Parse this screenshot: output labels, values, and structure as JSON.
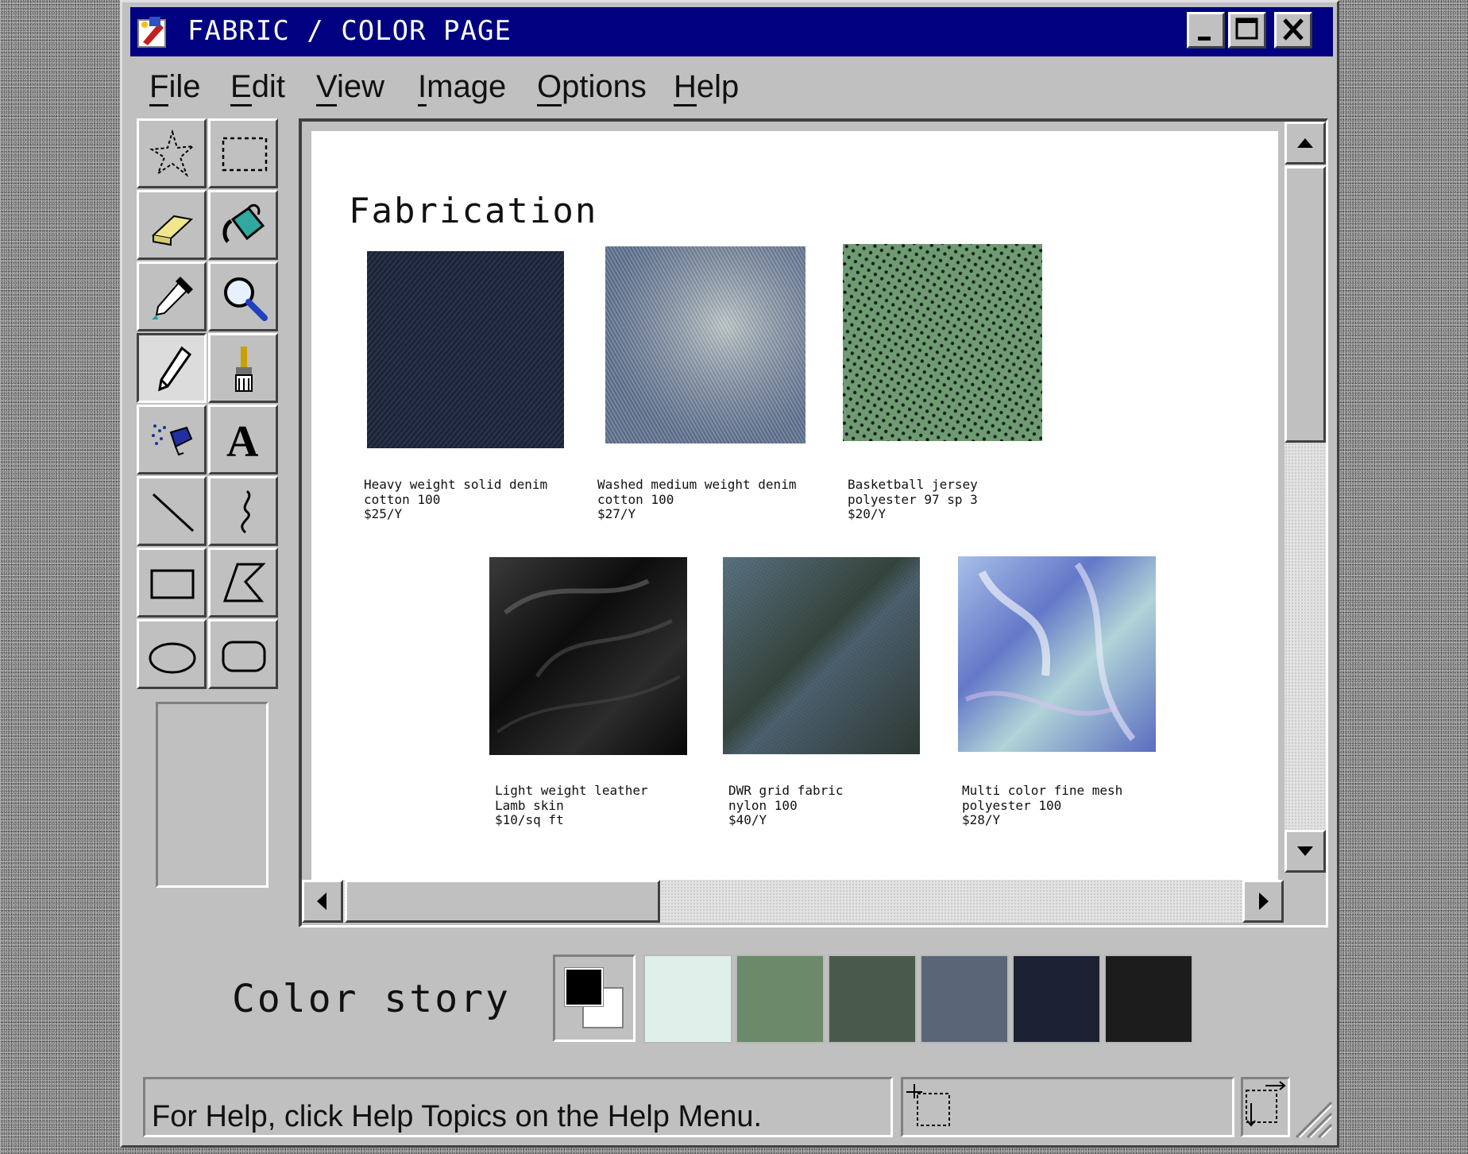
{
  "window": {
    "title": "FABRIC / COLOR PAGE",
    "icon": "paint-app-icon",
    "controls": [
      "minimize-icon",
      "maximize-icon",
      "close-icon"
    ]
  },
  "menu": {
    "items": [
      {
        "label": "File",
        "mnemonic": "F"
      },
      {
        "label": "Edit",
        "mnemonic": "E"
      },
      {
        "label": "View",
        "mnemonic": "V"
      },
      {
        "label": "Image",
        "mnemonic": "I"
      },
      {
        "label": "Options",
        "mnemonic": "O"
      },
      {
        "label": "Help",
        "mnemonic": "H"
      }
    ]
  },
  "tools": [
    "free-form-select-icon",
    "select-icon",
    "eraser-icon",
    "fill-bucket-icon",
    "color-picker-icon",
    "magnifier-icon",
    "pencil-icon",
    "brush-icon",
    "airbrush-icon",
    "text-icon",
    "line-icon",
    "curve-icon",
    "rectangle-icon",
    "polygon-icon",
    "ellipse-icon",
    "rounded-rectangle-icon"
  ],
  "selected_tool": "pencil-icon",
  "canvas": {
    "title": "Fabrication",
    "fabrics": [
      {
        "name": "Heavy weight solid denim",
        "content": "cotton 100",
        "price": "$25/Y",
        "color": "#1a2235"
      },
      {
        "name": "Washed medium weight denim",
        "content": "cotton 100",
        "price": "$27/Y",
        "color": "#7a8aa3"
      },
      {
        "name": "Basketball jersey",
        "content": "polyester 97 sp 3",
        "price": "$20/Y",
        "color": "#6f9a72"
      },
      {
        "name": "Light weight leather",
        "content": "Lamb skin",
        "price": "$10/sq ft",
        "color": "#1e1e1e"
      },
      {
        "name": "DWR grid fabric",
        "content": "nylon 100",
        "price": "$40/Y",
        "color": "#4f6470"
      },
      {
        "name": "Multi color fine mesh",
        "content": "polyester 100",
        "price": "$28/Y",
        "color": "#8ea3d8"
      }
    ]
  },
  "color_story": {
    "label": "Color story",
    "foreground": "#000000",
    "background": "#ffffff",
    "palette": [
      "#dff0eb",
      "#6a8a69",
      "#485a4b",
      "#5a6677",
      "#1c2233",
      "#1c1c1c"
    ]
  },
  "status": {
    "help_text": "For Help, click Help Topics on the Help Menu.",
    "position_icon": "cursor-position-icon",
    "size_icon": "selection-size-icon"
  }
}
